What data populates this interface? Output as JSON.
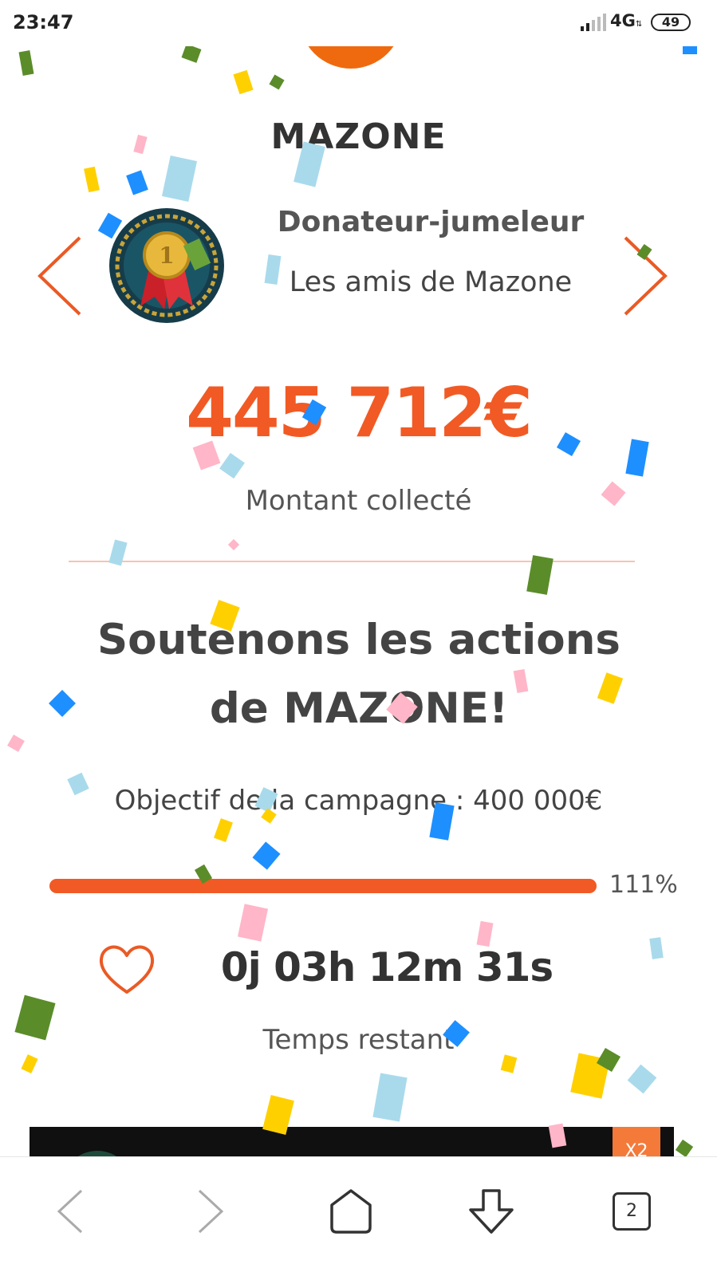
{
  "status_bar": {
    "time": "23:47",
    "network": "4G",
    "battery": "49"
  },
  "page": {
    "org_title": "MAZONE",
    "donor_type": "Donateur-jumeleur",
    "donor_group": "Les amis de Mazone",
    "badge_icon": "medal-badge-icon",
    "amount": "445 712€",
    "amount_label": "Montant collecté",
    "campaign_title_line1": "Soutenons les actions",
    "campaign_title_line2": "de MAZONE!",
    "goal": "Objectif de la campagne : 400 000€",
    "progress_percent": 111,
    "progress_label": "111%",
    "countdown": "0j 03h 12m 31s",
    "countdown_label": "Temps restant",
    "video_badge": "X2"
  },
  "browser_bar": {
    "tabs_count": "2"
  },
  "colors": {
    "accent": "#f15a24",
    "logo": "#ef6a0e",
    "text_dark": "#333333"
  }
}
